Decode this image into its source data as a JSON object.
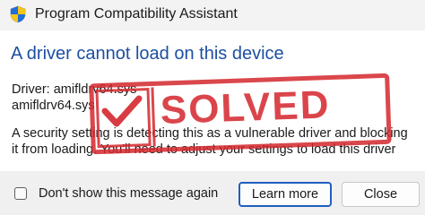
{
  "window": {
    "title": "Program Compatibility Assistant",
    "title_icon": "uac-shield-icon"
  },
  "content": {
    "heading": "A driver cannot load on this device",
    "driver_label_line": "Driver: amifldrv64.sys",
    "driver_file_line": "amifldrv64.sys",
    "message": "A security setting is detecting this as a vulnerable driver and blocking it from loading. You'll need to adjust your settings to load this driver"
  },
  "footer": {
    "checkbox_label": "Don't show this message again",
    "checkbox_checked": false,
    "learn_more_label": "Learn more",
    "close_label": "Close"
  },
  "stamp": {
    "text": "SOLVED",
    "icon": "checkmark-icon",
    "color": "#d4272d"
  },
  "colors": {
    "heading": "#1d4fa0",
    "accent_border": "#1f5fbf"
  }
}
